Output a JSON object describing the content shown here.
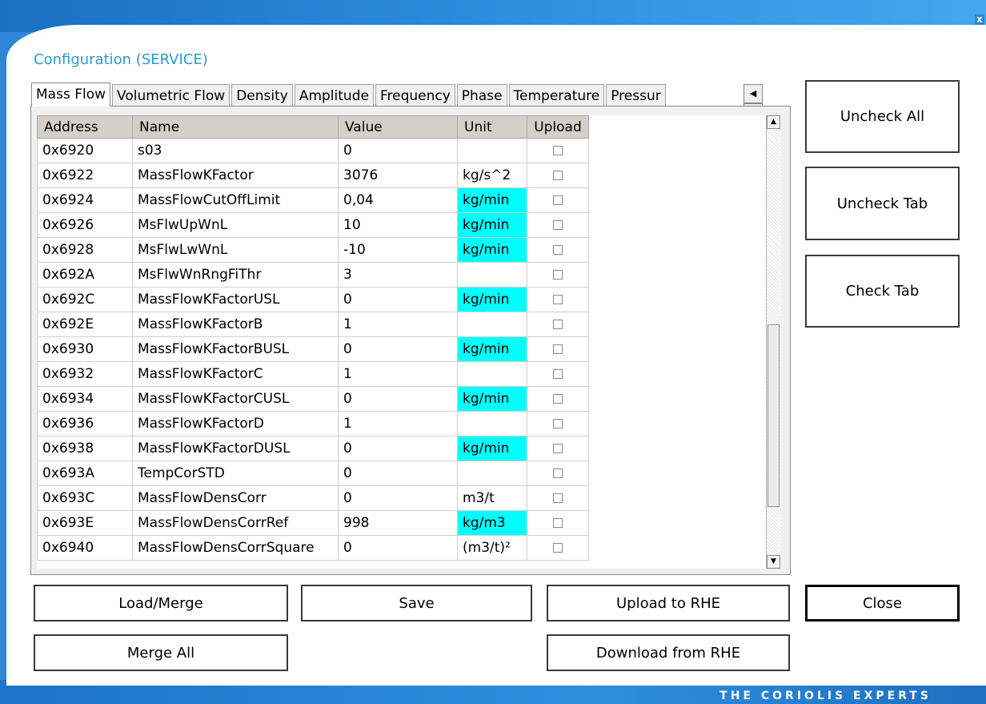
{
  "window": {
    "close_glyph": "x",
    "title": "Configuration (SERVICE)",
    "brand": "THE CORIOLIS EXPERTS"
  },
  "tabs": [
    {
      "label": "Mass Flow",
      "active": true
    },
    {
      "label": "Volumetric Flow",
      "active": false
    },
    {
      "label": "Density",
      "active": false
    },
    {
      "label": "Amplitude",
      "active": false
    },
    {
      "label": "Frequency",
      "active": false
    },
    {
      "label": "Phase",
      "active": false
    },
    {
      "label": "Temperature",
      "active": false
    },
    {
      "label": "Pressur",
      "active": false
    }
  ],
  "tab_scroll": {
    "left": "◀",
    "right": "▶"
  },
  "table": {
    "headers": {
      "address": "Address",
      "name": "Name",
      "value": "Value",
      "unit": "Unit",
      "upload": "Upload"
    },
    "rows": [
      {
        "address": "0x6920",
        "name": "s03",
        "value": "0",
        "unit": "",
        "highlight": false
      },
      {
        "address": "0x6922",
        "name": "MassFlowKFactor",
        "value": "3076",
        "unit": "kg/s^2",
        "highlight": false
      },
      {
        "address": "0x6924",
        "name": "MassFlowCutOffLimit",
        "value": "0,04",
        "unit": "kg/min",
        "highlight": true
      },
      {
        "address": "0x6926",
        "name": "MsFlwUpWnL",
        "value": "10",
        "unit": "kg/min",
        "highlight": true
      },
      {
        "address": "0x6928",
        "name": "MsFlwLwWnL",
        "value": "-10",
        "unit": "kg/min",
        "highlight": true
      },
      {
        "address": "0x692A",
        "name": "MsFlwWnRngFiThr",
        "value": "3",
        "unit": "",
        "highlight": false
      },
      {
        "address": "0x692C",
        "name": "MassFlowKFactorUSL",
        "value": "0",
        "unit": "kg/min",
        "highlight": true
      },
      {
        "address": "0x692E",
        "name": "MassFlowKFactorB",
        "value": "1",
        "unit": "",
        "highlight": false
      },
      {
        "address": "0x6930",
        "name": "MassFlowKFactorBUSL",
        "value": "0",
        "unit": "kg/min",
        "highlight": true
      },
      {
        "address": "0x6932",
        "name": "MassFlowKFactorC",
        "value": "1",
        "unit": "",
        "highlight": false
      },
      {
        "address": "0x6934",
        "name": "MassFlowKFactorCUSL",
        "value": "0",
        "unit": "kg/min",
        "highlight": true
      },
      {
        "address": "0x6936",
        "name": "MassFlowKFactorD",
        "value": "1",
        "unit": "",
        "highlight": false
      },
      {
        "address": "0x6938",
        "name": "MassFlowKFactorDUSL",
        "value": "0",
        "unit": "kg/min",
        "highlight": true
      },
      {
        "address": "0x693A",
        "name": "TempCorSTD",
        "value": "0",
        "unit": "",
        "highlight": false
      },
      {
        "address": "0x693C",
        "name": "MassFlowDensCorr",
        "value": "0",
        "unit": "m3/t",
        "highlight": false
      },
      {
        "address": "0x693E",
        "name": "MassFlowDensCorrRef",
        "value": "998",
        "unit": "kg/m3",
        "highlight": true
      },
      {
        "address": "0x6940",
        "name": "MassFlowDensCorrSquare",
        "value": "0",
        "unit": "(m3/t)²",
        "highlight": false
      }
    ]
  },
  "buttons": {
    "uncheck_all": "Uncheck All",
    "uncheck_tab": "Uncheck Tab",
    "check_tab": "Check Tab",
    "load_merge": "Load/Merge",
    "save": "Save",
    "upload": "Upload to RHE",
    "close": "Close",
    "merge_all": "Merge All",
    "download": "Download from RHE"
  },
  "colors": {
    "highlight_cyan": "#00ffff",
    "title_blue": "#2a9ad2",
    "frame_blue": "#2f86d6"
  }
}
